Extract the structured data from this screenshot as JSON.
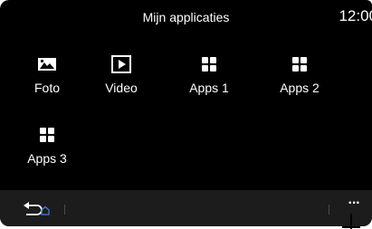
{
  "header": {
    "title": "Mijn applicaties",
    "clock": "12:00"
  },
  "apps": [
    {
      "label": "Foto",
      "icon": "photo-icon"
    },
    {
      "label": "Video",
      "icon": "play-icon"
    },
    {
      "label": "Apps 1",
      "icon": "grid-icon"
    },
    {
      "label": "Apps 2",
      "icon": "grid-icon"
    },
    {
      "label": "Apps 3",
      "icon": "grid-icon"
    }
  ],
  "bottombar": {
    "back_icon": "back-home-icon",
    "more_label": "···",
    "accent_color": "#4a7bd0"
  },
  "colors": {
    "background": "#000000",
    "bar": "#1c1c1c",
    "text": "#ffffff"
  }
}
